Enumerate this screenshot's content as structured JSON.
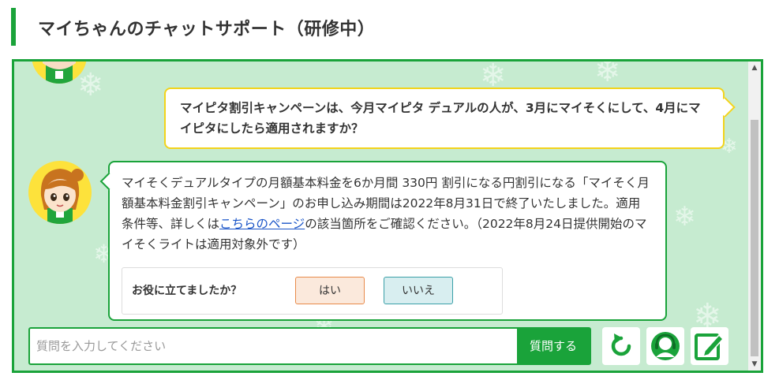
{
  "header": {
    "title": "マイちゃんのチャットサポート（研修中）"
  },
  "conversation": {
    "user_message": "マイピタ割引キャンペーンは、今月マイピタ デュアルの人が、3月にマイそくにして、4月にマイピタにしたら適用されますか？",
    "bot_message": {
      "text_before_link": "マイそくデュアルタイプの月額基本料金を6か月間 330円 割引になる円割引になる「マイそく月額基本料金割引キャンペーン」のお申し込み期間は2022年8月31日で終了いたしました。適用条件等、詳しくは",
      "link_text": "こちらのページ",
      "text_after_link": "の該当箇所をご確認ください。（2022年8月24日提供開始のマイそくライトは適用対象外です）"
    },
    "feedback": {
      "question": "お役に立てましたか？",
      "yes_label": "はい",
      "no_label": "いいえ"
    }
  },
  "input": {
    "placeholder": "質問を入力してください",
    "value": "",
    "submit_label": "質問する"
  },
  "toolbar": [
    {
      "icon": "reset-icon"
    },
    {
      "icon": "operator-headset-icon"
    },
    {
      "icon": "edit-icon"
    }
  ],
  "colors": {
    "brand_green": "#1aa33a",
    "chat_background": "#c6ebd0",
    "user_bubble_border": "#f2d31b",
    "link": "#1a55c8"
  }
}
